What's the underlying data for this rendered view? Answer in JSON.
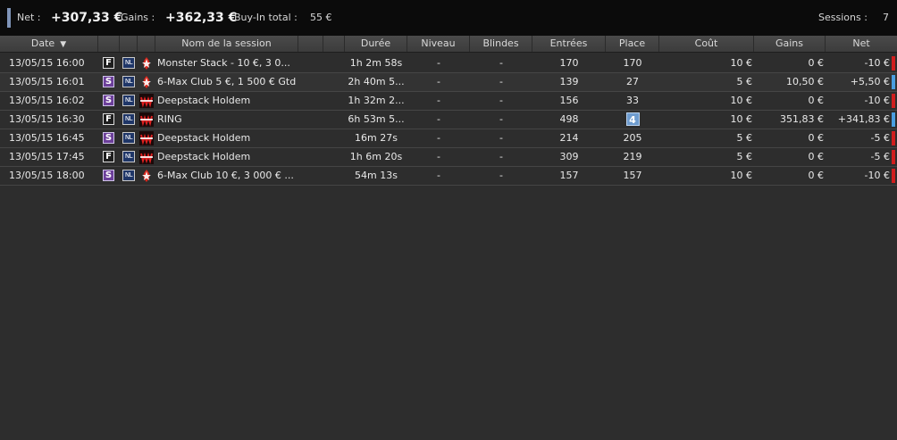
{
  "summary": {
    "net_label": "Net :",
    "net_value": "+307,33 €",
    "gains_label": "Gains :",
    "gains_value": "+362,33 €",
    "buyin_label": "Buy-In total :",
    "buyin_value": "55 €",
    "sessions_label": "Sessions :",
    "sessions_value": "7"
  },
  "columns": {
    "date": "Date",
    "name": "Nom de la session",
    "duration": "Durée",
    "level": "Niveau",
    "blinds": "Blindes",
    "entries": "Entrées",
    "place": "Place",
    "cost": "Coût",
    "gains": "Gains",
    "net": "Net"
  },
  "sort": {
    "column": "date",
    "direction": "descending",
    "icon": "sort-descending-icon"
  },
  "colors": {
    "positive_net": "#4a9ee0",
    "negative_net": "#d01e1e",
    "accent": "#7f94b8"
  },
  "rows": [
    {
      "date": "13/05/15 16:00",
      "type": "F",
      "limit": "NL",
      "room": "pokerstars-icon",
      "name": "Monster Stack - 10 €, 3 0...",
      "duration": "1h 2m 58s",
      "level": "-",
      "blinds": "-",
      "entries": "170",
      "place": "170",
      "place_highlight": false,
      "cost": "10 €",
      "gains": "0 €",
      "net": "-10 €",
      "net_status": "negative"
    },
    {
      "date": "13/05/15 16:01",
      "type": "S",
      "limit": "NL",
      "room": "pokerstars-icon",
      "name": "6-Max Club 5 €, 1 500 € Gtd",
      "duration": "2h 40m 5...",
      "level": "-",
      "blinds": "-",
      "entries": "139",
      "place": "27",
      "place_highlight": false,
      "cost": "5 €",
      "gains": "10,50 €",
      "net": "+5,50 €",
      "net_status": "positive"
    },
    {
      "date": "13/05/15 16:02",
      "type": "S",
      "limit": "NL",
      "room": "winamax-icon",
      "name": "Deepstack Holdem",
      "duration": "1h 32m 2...",
      "level": "-",
      "blinds": "-",
      "entries": "156",
      "place": "33",
      "place_highlight": false,
      "cost": "10 €",
      "gains": "0 €",
      "net": "-10 €",
      "net_status": "negative"
    },
    {
      "date": "13/05/15 16:30",
      "type": "F",
      "limit": "NL",
      "room": "winamax-icon",
      "name": "RING",
      "duration": "6h 53m 5...",
      "level": "-",
      "blinds": "-",
      "entries": "498",
      "place": "4",
      "place_highlight": true,
      "cost": "10 €",
      "gains": "351,83 €",
      "net": "+341,83 €",
      "net_status": "positive"
    },
    {
      "date": "13/05/15 16:45",
      "type": "S",
      "limit": "NL",
      "room": "winamax-icon",
      "name": "Deepstack Holdem",
      "duration": "16m 27s",
      "level": "-",
      "blinds": "-",
      "entries": "214",
      "place": "205",
      "place_highlight": false,
      "cost": "5 €",
      "gains": "0 €",
      "net": "-5 €",
      "net_status": "negative"
    },
    {
      "date": "13/05/15 17:45",
      "type": "F",
      "limit": "NL",
      "room": "winamax-icon",
      "name": "Deepstack Holdem",
      "duration": "1h 6m 20s",
      "level": "-",
      "blinds": "-",
      "entries": "309",
      "place": "219",
      "place_highlight": false,
      "cost": "5 €",
      "gains": "0 €",
      "net": "-5 €",
      "net_status": "negative"
    },
    {
      "date": "13/05/15 18:00",
      "type": "S",
      "limit": "NL",
      "room": "pokerstars-icon",
      "name": "6-Max Club 10 €, 3 000 € ...",
      "duration": "54m 13s",
      "level": "-",
      "blinds": "-",
      "entries": "157",
      "place": "157",
      "place_highlight": false,
      "cost": "10 €",
      "gains": "0 €",
      "net": "-10 €",
      "net_status": "negative"
    }
  ]
}
